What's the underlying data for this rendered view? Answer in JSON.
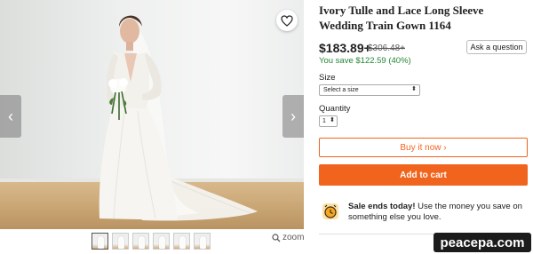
{
  "gallery": {
    "prev_arrow": "‹",
    "next_arrow": "›",
    "thumbnail_count": 6,
    "active_thumbnail": 0,
    "zoom_label": "zoom"
  },
  "product": {
    "title": "Ivory Tulle and Lace Long Sleeve Wedding Train Gown 1164",
    "price": "$183.89+",
    "original_price": "$306.48+",
    "savings": "You save $122.59 (40%)",
    "ask_question": "Ask a question"
  },
  "options": {
    "size_label": "Size",
    "size_placeholder": "Select a size",
    "quantity_label": "Quantity",
    "quantity_value": "1"
  },
  "actions": {
    "buy_now": "Buy it now ›",
    "add_to_cart": "Add to cart"
  },
  "sale": {
    "headline": "Sale ends today!",
    "message": "Use the money you save on something else you love."
  },
  "watermark": "peacepa.com",
  "colors": {
    "accent": "#f1641e",
    "savings": "#258635"
  }
}
